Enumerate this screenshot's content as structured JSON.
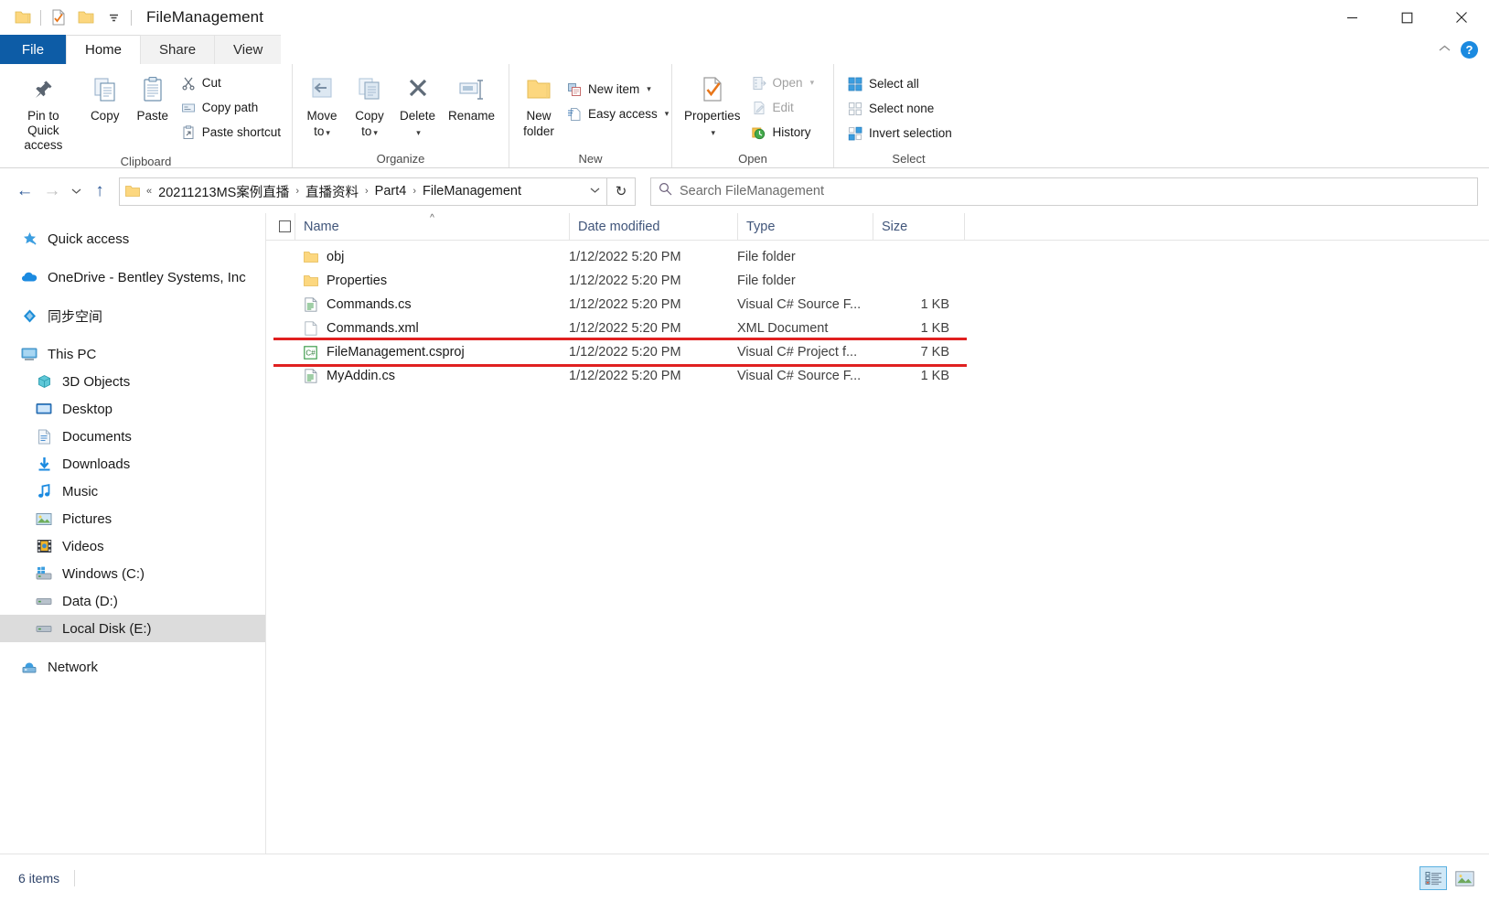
{
  "window": {
    "title": "FileManagement",
    "quick_access": [
      {
        "name": "folder-icon",
        "label": "Folder"
      },
      {
        "name": "properties-icon",
        "label": "Properties"
      },
      {
        "name": "new-folder-icon",
        "label": "New folder"
      },
      {
        "name": "customize-qat-dropdown",
        "label": "Customize Quick Access Toolbar"
      }
    ],
    "controls": {
      "minimize": "—",
      "maximize": "☐",
      "close": "✕",
      "collapse_ribbon": "⌃",
      "help": "?"
    }
  },
  "tabs": [
    {
      "label": "File",
      "active": false,
      "kind": "file"
    },
    {
      "label": "Home",
      "active": true,
      "kind": "normal"
    },
    {
      "label": "Share",
      "active": false,
      "kind": "normal"
    },
    {
      "label": "View",
      "active": false,
      "kind": "normal"
    }
  ],
  "ribbon": {
    "groups": [
      {
        "label": "Clipboard",
        "big": [
          {
            "label_line1": "Pin to Quick",
            "label_line2": "access",
            "icon": "pin-icon"
          },
          {
            "label_line1": "Copy",
            "label_line2": "",
            "icon": "copy-icon"
          },
          {
            "label_line1": "Paste",
            "label_line2": "",
            "icon": "paste-icon"
          }
        ],
        "small": [
          {
            "label": "Cut",
            "icon": "scissors-icon",
            "disabled": false,
            "caret": false
          },
          {
            "label": "Copy path",
            "icon": "copy-path-icon",
            "disabled": false,
            "caret": false
          },
          {
            "label": "Paste shortcut",
            "icon": "paste-shortcut-icon",
            "disabled": false,
            "caret": false
          }
        ]
      },
      {
        "label": "Organize",
        "big": [
          {
            "label_line1": "Move",
            "label_line2": "to",
            "icon": "move-to-icon",
            "caret": true
          },
          {
            "label_line1": "Copy",
            "label_line2": "to",
            "icon": "copy-to-icon",
            "caret": true
          },
          {
            "label_line1": "Delete",
            "label_line2": "",
            "icon": "delete-icon",
            "caret": true
          },
          {
            "label_line1": "Rename",
            "label_line2": "",
            "icon": "rename-icon",
            "caret": false
          }
        ],
        "small": []
      },
      {
        "label": "New",
        "big": [
          {
            "label_line1": "New",
            "label_line2": "folder",
            "icon": "new-folder-icon"
          }
        ],
        "small": [
          {
            "label": "New item",
            "icon": "new-item-icon",
            "disabled": false,
            "caret": true
          },
          {
            "label": "Easy access",
            "icon": "easy-access-icon",
            "disabled": false,
            "caret": true
          }
        ]
      },
      {
        "label": "Open",
        "big": [
          {
            "label_line1": "Properties",
            "label_line2": "",
            "icon": "properties-icon",
            "caret": true
          }
        ],
        "small": [
          {
            "label": "Open",
            "icon": "open-icon",
            "disabled": true,
            "caret": true
          },
          {
            "label": "Edit",
            "icon": "edit-icon",
            "disabled": true,
            "caret": false
          },
          {
            "label": "History",
            "icon": "history-icon",
            "disabled": false,
            "caret": false
          }
        ]
      },
      {
        "label": "Select",
        "big": [],
        "small": [
          {
            "label": "Select all",
            "icon": "select-all-icon",
            "disabled": false,
            "caret": false
          },
          {
            "label": "Select none",
            "icon": "select-none-icon",
            "disabled": false,
            "caret": false
          },
          {
            "label": "Invert selection",
            "icon": "invert-selection-icon",
            "disabled": false,
            "caret": false
          }
        ]
      }
    ]
  },
  "address_bar": {
    "back": "←",
    "forward": "→",
    "recent_dropdown": "⌄",
    "up": "↑",
    "overflow": "«",
    "breadcrumbs": [
      "20211213MS案例直播",
      "直播资料",
      "Part4",
      "FileManagement"
    ],
    "breadcrumb_separator": "›",
    "dropdown": "⌄",
    "refresh": "↻"
  },
  "search": {
    "placeholder": "Search FileManagement",
    "icon": "search-icon"
  },
  "sidebar": {
    "items": [
      {
        "label": "Quick access",
        "icon": "pin-star-icon",
        "indent": false,
        "selected": false,
        "gap_before": false
      },
      {
        "label": "OneDrive - Bentley Systems, Inc",
        "icon": "onedrive-cloud-icon",
        "indent": false,
        "selected": false,
        "gap_before": true
      },
      {
        "label": "同步空间",
        "icon": "sync-space-icon",
        "indent": false,
        "selected": false,
        "gap_before": true
      },
      {
        "label": "This PC",
        "icon": "this-pc-icon",
        "indent": false,
        "selected": false,
        "gap_before": true
      },
      {
        "label": "3D Objects",
        "icon": "3d-objects-icon",
        "indent": true,
        "selected": false,
        "gap_before": false
      },
      {
        "label": "Desktop",
        "icon": "desktop-icon",
        "indent": true,
        "selected": false,
        "gap_before": false
      },
      {
        "label": "Documents",
        "icon": "documents-icon",
        "indent": true,
        "selected": false,
        "gap_before": false
      },
      {
        "label": "Downloads",
        "icon": "downloads-icon",
        "indent": true,
        "selected": false,
        "gap_before": false
      },
      {
        "label": "Music",
        "icon": "music-icon",
        "indent": true,
        "selected": false,
        "gap_before": false
      },
      {
        "label": "Pictures",
        "icon": "pictures-icon",
        "indent": true,
        "selected": false,
        "gap_before": false
      },
      {
        "label": "Videos",
        "icon": "videos-icon",
        "indent": true,
        "selected": false,
        "gap_before": false
      },
      {
        "label": "Windows (C:)",
        "icon": "windows-drive-icon",
        "indent": true,
        "selected": false,
        "gap_before": false
      },
      {
        "label": "Data (D:)",
        "icon": "drive-icon",
        "indent": true,
        "selected": false,
        "gap_before": false
      },
      {
        "label": "Local Disk (E:)",
        "icon": "drive-icon",
        "indent": true,
        "selected": true,
        "gap_before": false
      },
      {
        "label": "Network",
        "icon": "network-icon",
        "indent": false,
        "selected": false,
        "gap_before": true
      }
    ]
  },
  "file_list": {
    "columns": [
      {
        "label": "Name",
        "sorted": "asc"
      },
      {
        "label": "Date modified",
        "sorted": ""
      },
      {
        "label": "Type",
        "sorted": ""
      },
      {
        "label": "Size",
        "sorted": ""
      }
    ],
    "select_all_checkbox": false,
    "rows": [
      {
        "name": "obj",
        "date": "1/12/2022 5:20 PM",
        "type": "File folder",
        "size": "",
        "icon": "folder-icon",
        "highlighted": false
      },
      {
        "name": "Properties",
        "date": "1/12/2022 5:20 PM",
        "type": "File folder",
        "size": "",
        "icon": "folder-icon",
        "highlighted": false
      },
      {
        "name": "Commands.cs",
        "date": "1/12/2022 5:20 PM",
        "type": "Visual C# Source F...",
        "size": "1 KB",
        "icon": "cs-file-icon",
        "highlighted": false
      },
      {
        "name": "Commands.xml",
        "date": "1/12/2022 5:20 PM",
        "type": "XML Document",
        "size": "1 KB",
        "icon": "xml-file-icon",
        "highlighted": false
      },
      {
        "name": "FileManagement.csproj",
        "date": "1/12/2022 5:20 PM",
        "type": "Visual C# Project f...",
        "size": "7 KB",
        "icon": "csproj-file-icon",
        "highlighted": true
      },
      {
        "name": "MyAddin.cs",
        "date": "1/12/2022 5:20 PM",
        "type": "Visual C# Source F...",
        "size": "1 KB",
        "icon": "cs-file-icon",
        "highlighted": false
      }
    ]
  },
  "status_bar": {
    "item_count": "6 items",
    "views": [
      {
        "name": "details-view-button",
        "label": "Details view",
        "active": true
      },
      {
        "name": "large-icons-view-button",
        "label": "Large icons view",
        "active": false
      }
    ]
  },
  "colors": {
    "accent_blue": "#0d5ca6",
    "annotation_red": "#e02020",
    "folder_yellow": "#fcd77f",
    "selection_gray": "#dcdcdc"
  }
}
